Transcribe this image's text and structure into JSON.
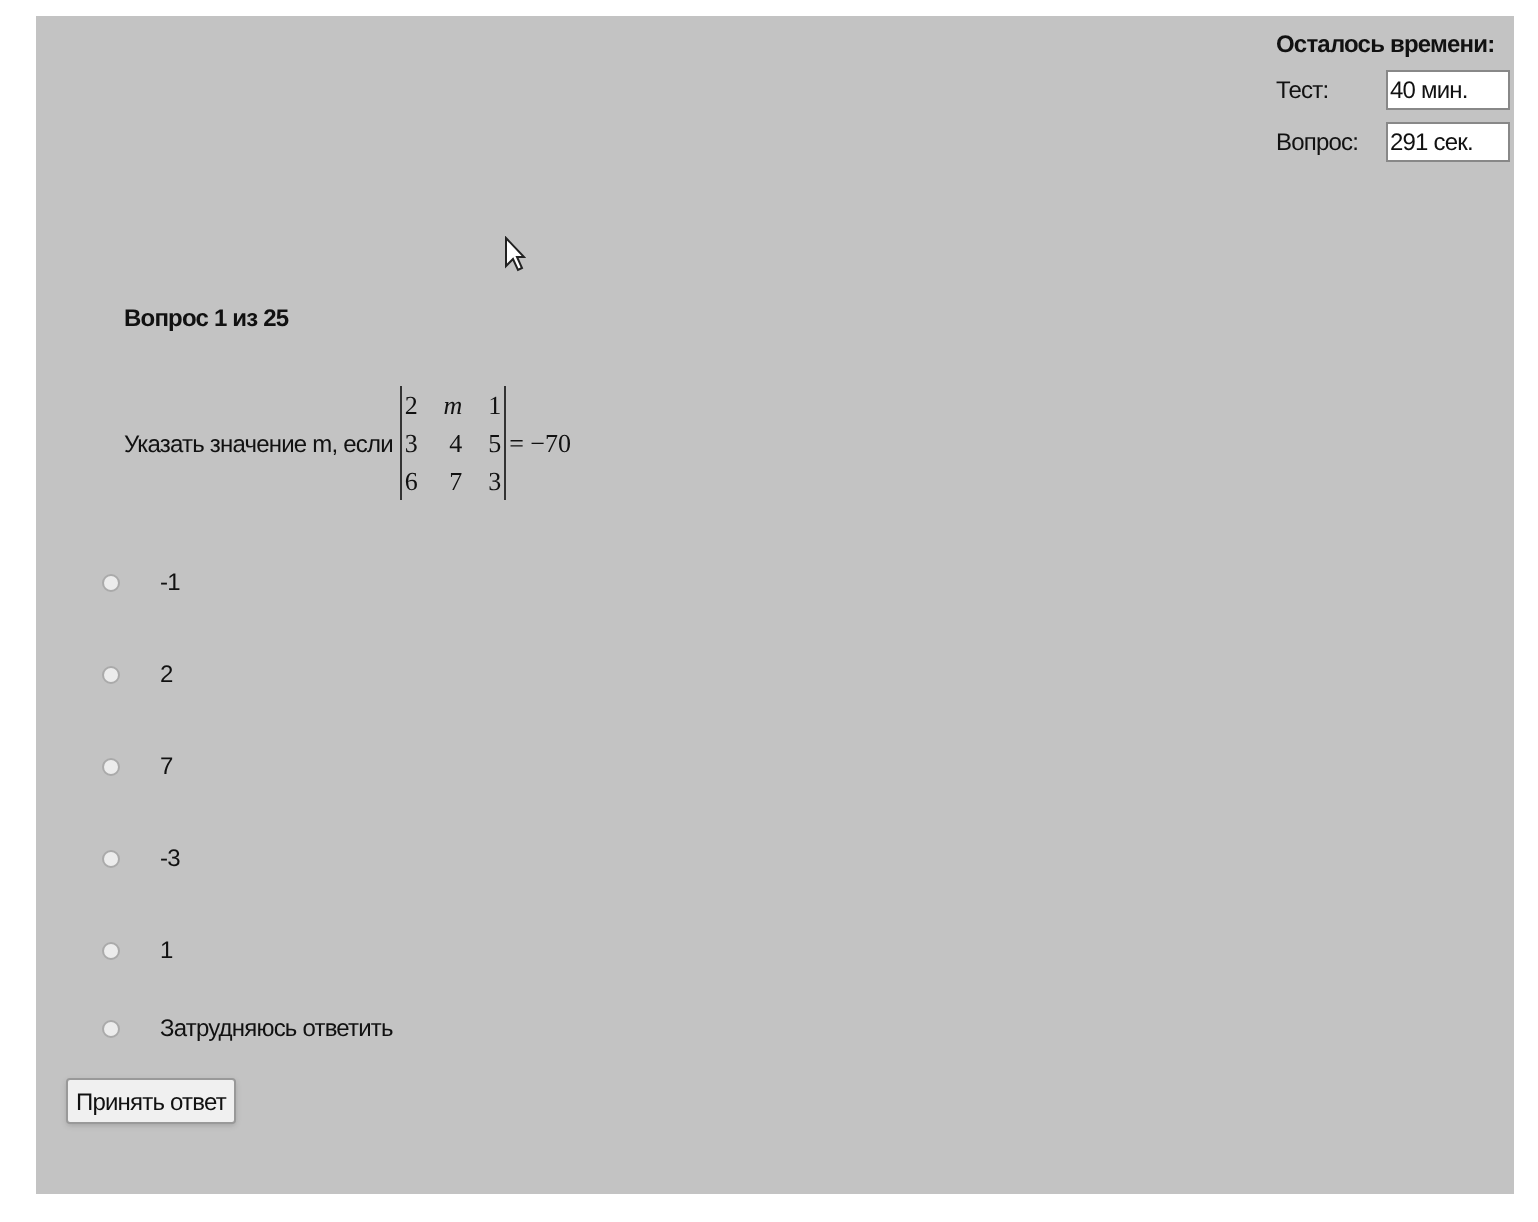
{
  "timer": {
    "title": "Осталось времени:",
    "fields": [
      {
        "label": "Тест:",
        "value": "40 мин."
      },
      {
        "label": "Вопрос:",
        "value": "291 сек."
      }
    ]
  },
  "question": {
    "counter": "Вопрос 1 из 25",
    "text": "Указать значение m, если",
    "matrix": [
      [
        "2",
        "m",
        "1"
      ],
      [
        "3",
        "4",
        "5"
      ],
      [
        "6",
        "7",
        "3"
      ]
    ],
    "result": "= −70"
  },
  "options": [
    {
      "label": "-1",
      "selected": false
    },
    {
      "label": "2",
      "selected": false
    },
    {
      "label": "7",
      "selected": false
    },
    {
      "label": "-3",
      "selected": false
    },
    {
      "label": "1",
      "selected": false
    },
    {
      "label": "Затрудняюсь ответить",
      "selected": false
    }
  ],
  "submit": "Принять ответ"
}
